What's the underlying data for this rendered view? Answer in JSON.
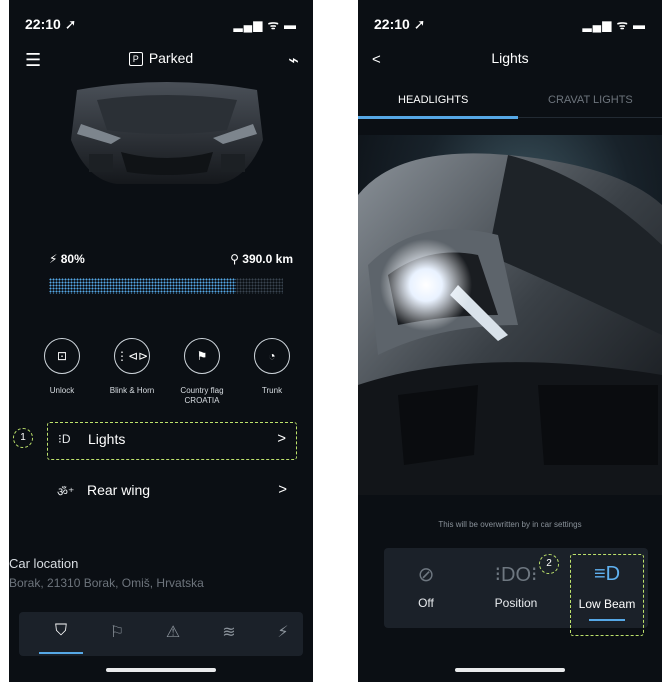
{
  "left": {
    "status": {
      "time": "22:10 ➚",
      "signal": "▂▄▆ ᯤ ▬"
    },
    "header": {
      "menu_icon": "☰",
      "status_icon": "P",
      "status": "Parked",
      "activity_icon": "⌁"
    },
    "battery": {
      "percent": "⚡ 80%",
      "range": "⚲ 390.0 km",
      "charge_fraction": 0.8
    },
    "actions": [
      {
        "icon": "⊡",
        "label": "Unlock",
        "label2": ""
      },
      {
        "icon": "⋮⊲⊳",
        "label": "Blink & Horn",
        "label2": ""
      },
      {
        "icon": "⚑",
        "label": "Country flag",
        "label2": "CROATIA"
      },
      {
        "icon": "◔",
        "label": "Trunk",
        "label2": ""
      }
    ],
    "rows": [
      {
        "icon": "⁝D",
        "label": "Lights",
        "chevron": ">",
        "badge": "1"
      },
      {
        "icon": "ॐ⁺",
        "label": "Rear wing",
        "chevron": ">"
      }
    ],
    "location": {
      "title": "Car location",
      "address": "Borak, 21310 Borak, Omiš, Hrvatska"
    },
    "tabbar": [
      "⛉",
      "⚐",
      "⚠",
      "≋",
      "⚡"
    ]
  },
  "right": {
    "status": {
      "time": "22:10 ➚",
      "signal": "▂▄▆ ᯤ ▬"
    },
    "header": {
      "back": "<",
      "title": "Lights"
    },
    "tabs": [
      "HEADLIGHTS",
      "CRAVAT LIGHTS"
    ],
    "note": "This will be overwritten by in car settings",
    "modes": [
      {
        "icon": "⊘",
        "label": "Off"
      },
      {
        "icon": "⁝DO⁝",
        "label": "Position",
        "badge": "2"
      },
      {
        "icon": "≡D",
        "label": "Low Beam",
        "active": true
      }
    ]
  },
  "colors": {
    "accent": "#56a8e6",
    "annotation": "#bde26b",
    "background": "#0b0f14",
    "panel": "#1b2129"
  }
}
